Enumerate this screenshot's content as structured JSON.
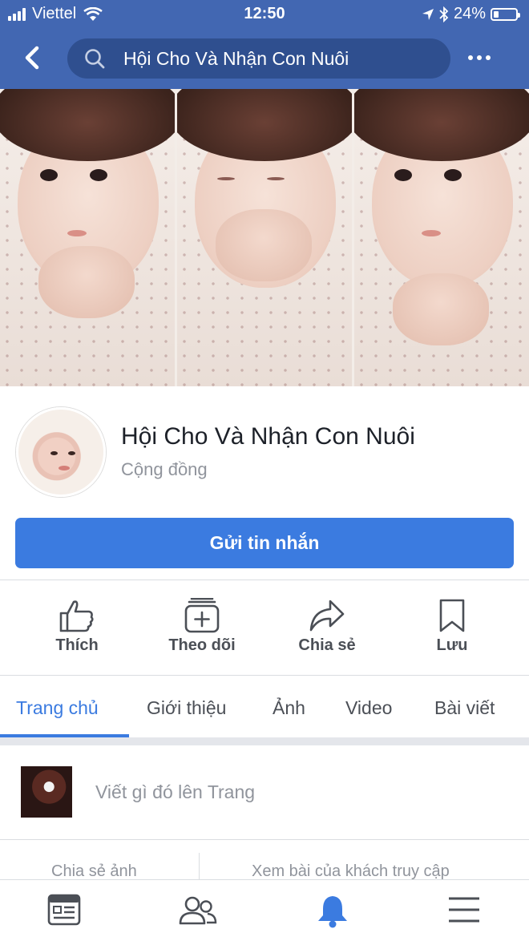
{
  "status": {
    "carrier": "Viettel",
    "time": "12:50",
    "battery": "24%",
    "battery_level": 0.24
  },
  "search": {
    "query": "Hội Cho Và Nhận Con Nuôi"
  },
  "page": {
    "name": "Hội Cho Và Nhận Con Nuôi",
    "category": "Cộng đồng"
  },
  "message_button": "Gửi tin nhắn",
  "actions": [
    {
      "label": "Thích",
      "icon": "like-icon"
    },
    {
      "label": "Theo dõi",
      "icon": "follow-icon"
    },
    {
      "label": "Chia sẻ",
      "icon": "share-icon"
    },
    {
      "label": "Lưu",
      "icon": "bookmark-icon"
    }
  ],
  "tabs": [
    {
      "label": "Trang chủ",
      "active": true
    },
    {
      "label": "Giới thiệu"
    },
    {
      "label": "Ảnh"
    },
    {
      "label": "Video"
    },
    {
      "label": "Bài viết"
    }
  ],
  "composer": {
    "placeholder": "Viết gì đó lên Trang"
  },
  "subactions": {
    "share_photo": "Chia sẻ ảnh",
    "visitor_posts": "Xem bài của khách truy cập"
  },
  "bottom_nav": [
    {
      "icon": "news-feed-icon"
    },
    {
      "icon": "friends-icon"
    },
    {
      "icon": "notifications-icon",
      "active": true
    },
    {
      "icon": "menu-icon"
    }
  ],
  "colors": {
    "header": "#4267b2",
    "accent": "#3b7be0",
    "text_secondary": "#90949c"
  }
}
